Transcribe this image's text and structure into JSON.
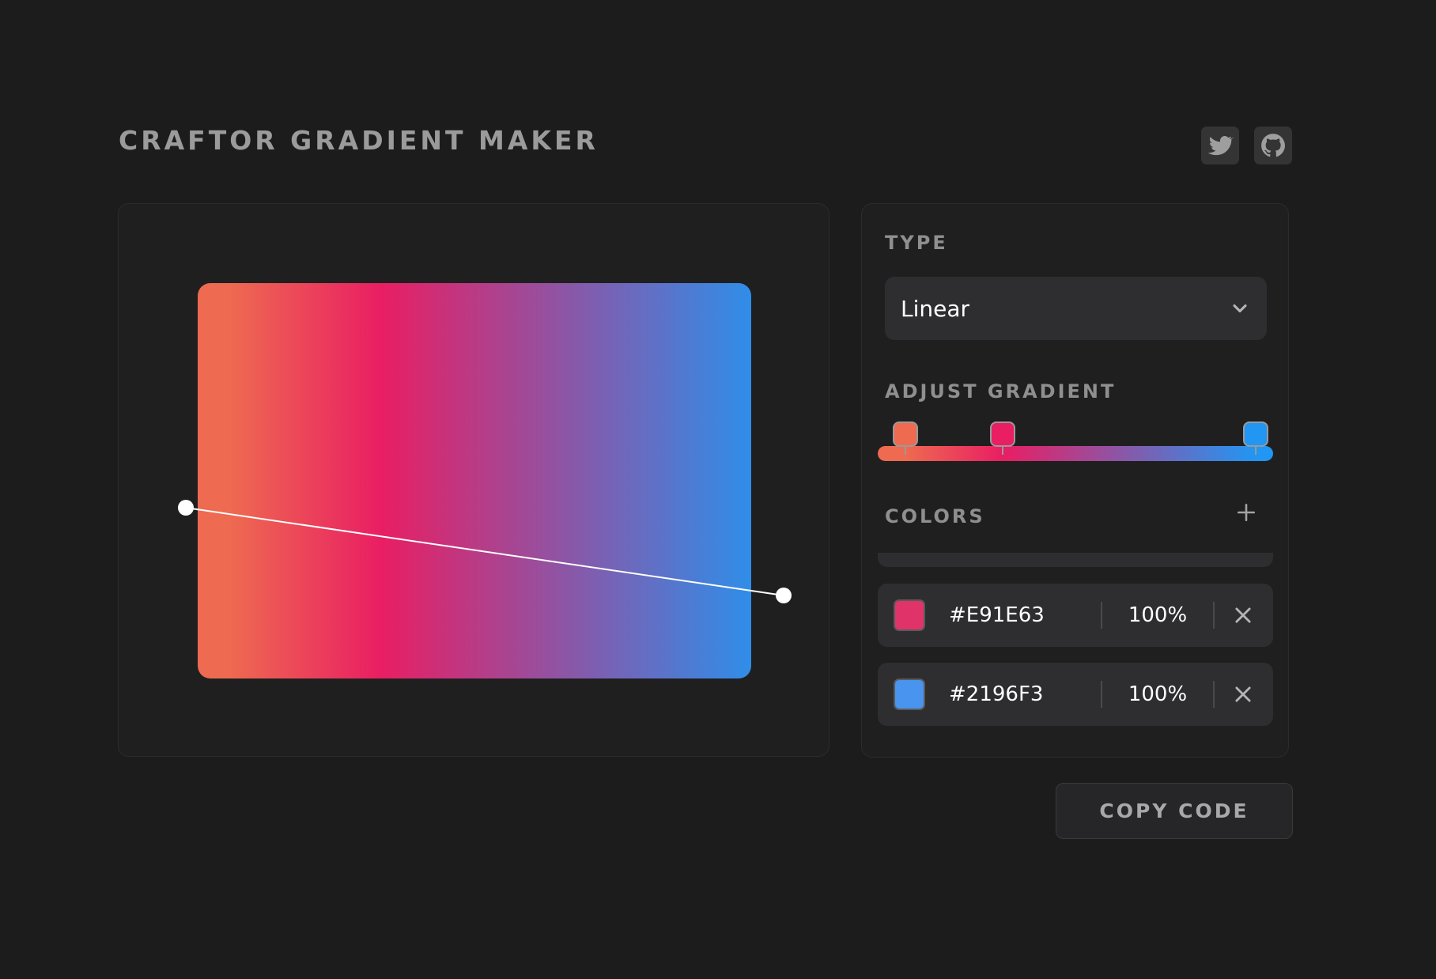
{
  "app": {
    "title": "CRAFTOR GRADIENT MAKER"
  },
  "header": {
    "links": [
      {
        "name": "twitter",
        "icon": "twitter-icon"
      },
      {
        "name": "github",
        "icon": "github-icon"
      }
    ]
  },
  "gradient": {
    "type": "Linear",
    "stops": [
      {
        "color": "#EE6A50",
        "position": 0.07
      },
      {
        "color": "#E91E63",
        "position": 0.315
      },
      {
        "color": "#2196F3",
        "position": 0.955
      }
    ],
    "line_handles": [
      {
        "label": "start-handle"
      },
      {
        "label": "end-handle"
      }
    ]
  },
  "controls": {
    "type_label": "TYPE",
    "type_value": "Linear",
    "adjust_label": "ADJUST GRADIENT",
    "colors_label": "COLORS",
    "colors": [
      {
        "hex": "#E91E63",
        "opacity": "100%",
        "swatch": "#E0336A"
      },
      {
        "hex": "#2196F3",
        "opacity": "100%",
        "swatch": "#4894EE"
      }
    ]
  },
  "actions": {
    "copy_label": "COPY CODE"
  },
  "icons": {
    "chevron": "chevron-down-icon",
    "add": "plus-icon",
    "remove": "close-icon"
  }
}
